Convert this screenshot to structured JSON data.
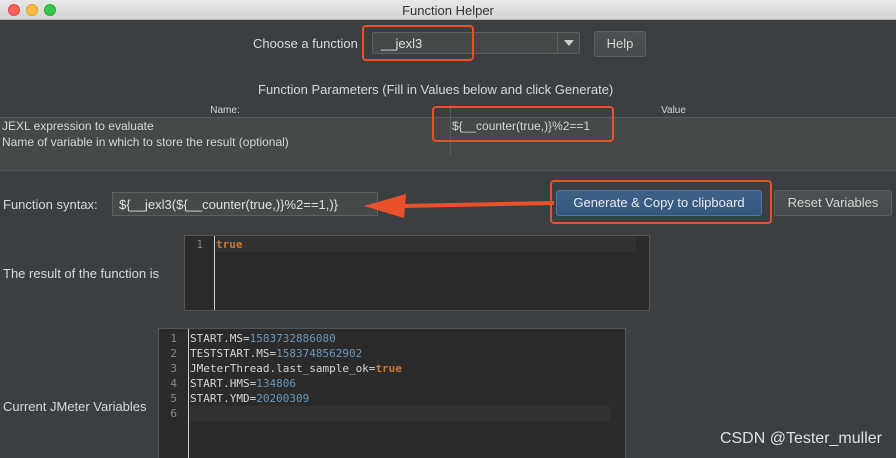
{
  "window": {
    "title": "Function Helper"
  },
  "chooser": {
    "label": "Choose a function",
    "selected": "__jexl3",
    "help_label": "Help"
  },
  "params": {
    "heading": "Function Parameters (Fill in Values below and click Generate)",
    "col_name": "Name:",
    "col_value": "Value",
    "rows": [
      {
        "name": "JEXL expression to evaluate",
        "value": "${__counter(true,)}%2==1"
      },
      {
        "name": "Name of variable in which to store the result (optional)",
        "value": ""
      }
    ]
  },
  "syntax": {
    "label": "Function syntax:",
    "value": "${__jexl3(${__counter(true,)}%2==1,)}",
    "generate_label": "Generate & Copy to clipboard",
    "reset_label": "Reset Variables"
  },
  "result": {
    "label": "The result of the function is",
    "lines": [
      {
        "n": "1",
        "text": "true"
      }
    ]
  },
  "variables": {
    "label": "Current JMeter Variables",
    "lines": [
      {
        "n": "1",
        "key": "START.MS=",
        "val": "1583732886080"
      },
      {
        "n": "2",
        "key": "TESTSTART.MS=",
        "val": "1583748562902"
      },
      {
        "n": "3",
        "key": "JMeterThread.last_sample_ok=",
        "val": "true"
      },
      {
        "n": "4",
        "key": "START.HMS=",
        "val": "134806"
      },
      {
        "n": "5",
        "key": "START.YMD=",
        "val": "20200309"
      },
      {
        "n": "6",
        "key": "",
        "val": ""
      }
    ]
  },
  "watermark": "CSDN @Tester_muller",
  "colors": {
    "annotation": "#e8512a",
    "keyword": "#cc7832",
    "number": "#6897bb"
  }
}
